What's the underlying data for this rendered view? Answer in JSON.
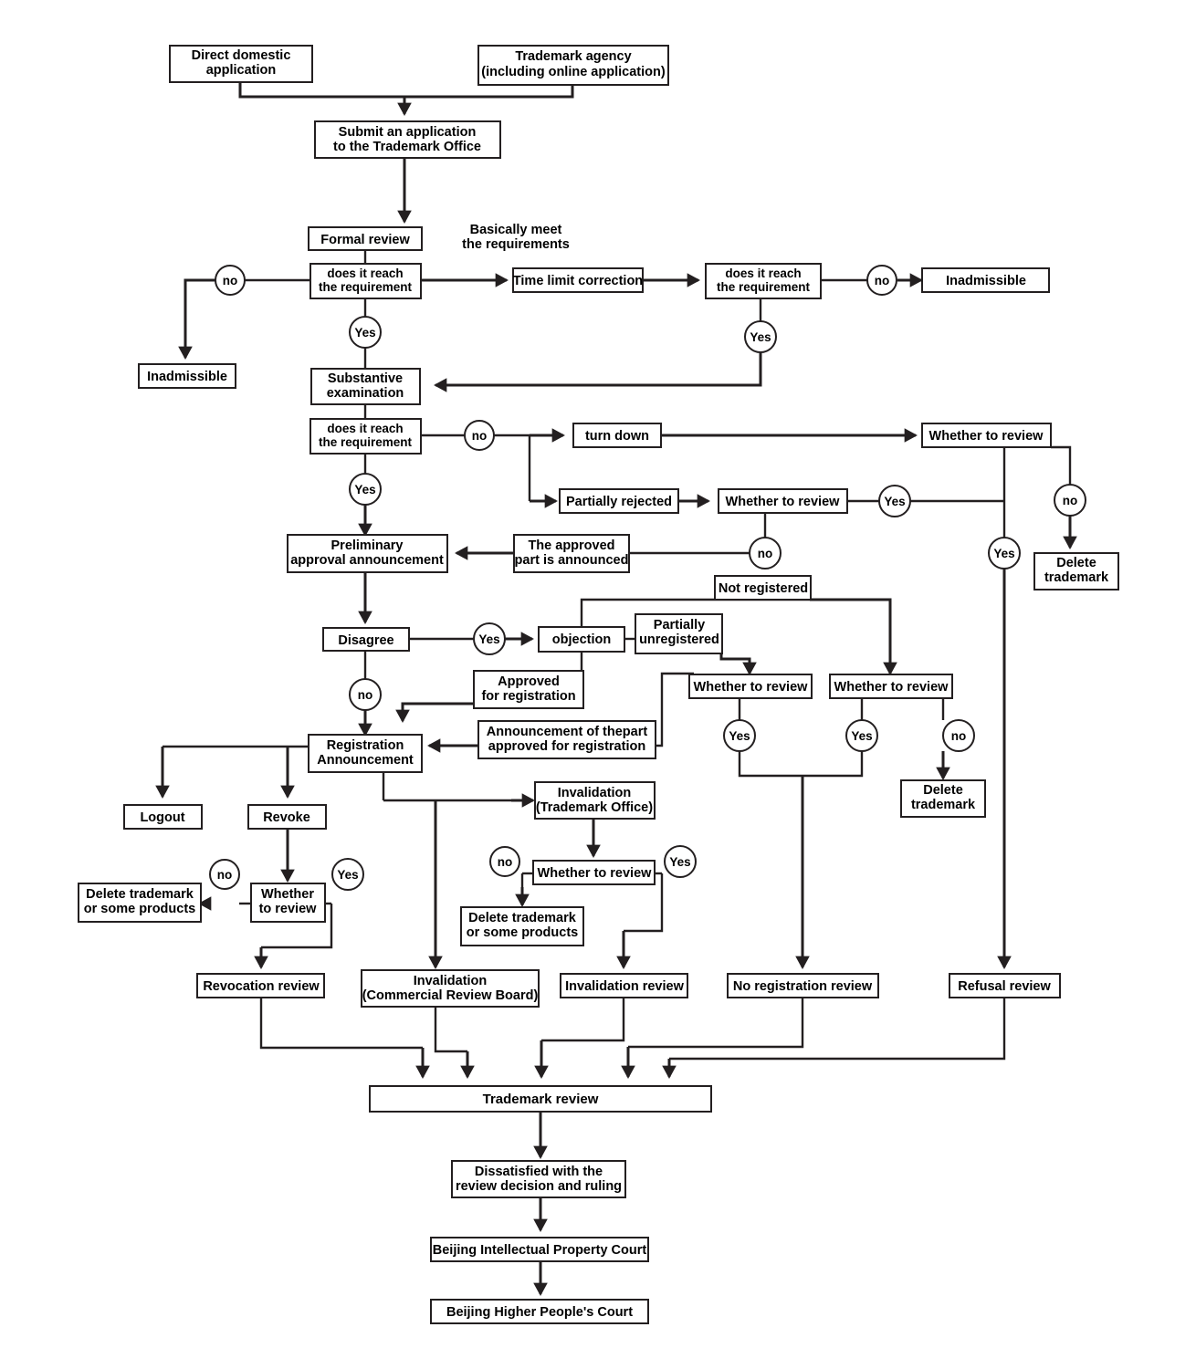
{
  "diagram": {
    "title": "Trademark application and review flowchart",
    "colors": {
      "line": "#231f20",
      "box_fill": "#ffffff",
      "background": "#ffffff"
    },
    "nodes": {
      "direct_domestic_application": {
        "lines": [
          "Direct domestic",
          "application"
        ]
      },
      "trademark_agency": {
        "lines": [
          "Trademark agency",
          "(including online application)"
        ]
      },
      "submit_application": {
        "lines": [
          "Submit an application",
          "to the Trademark Office"
        ]
      },
      "formal_review": {
        "lines": [
          "Formal review"
        ]
      },
      "formal_does_it_reach": {
        "lines": [
          "does it reach",
          "the requirement"
        ]
      },
      "inadmissible_left": {
        "lines": [
          "Inadmissible"
        ]
      },
      "time_limit_correction": {
        "lines": [
          "Time limit correction"
        ]
      },
      "correction_does_it_reach": {
        "lines": [
          "does it reach",
          "the requirement"
        ]
      },
      "inadmissible_right": {
        "lines": [
          "Inadmissible"
        ]
      },
      "substantive_examination": {
        "lines": [
          "Substantive",
          "examination"
        ]
      },
      "substantive_does_it_reach": {
        "lines": [
          "does it reach",
          "the requirement"
        ]
      },
      "turn_down": {
        "lines": [
          "turn down"
        ]
      },
      "whether_to_review_turndown": {
        "lines": [
          "Whether to review"
        ]
      },
      "partially_rejected": {
        "lines": [
          "Partially rejected"
        ]
      },
      "whether_to_review_partial": {
        "lines": [
          "Whether to review"
        ]
      },
      "delete_trademark_refusal": {
        "lines": [
          "Delete",
          "trademark"
        ]
      },
      "preliminary_approval": {
        "lines": [
          "Preliminary",
          "approval announcement"
        ]
      },
      "approved_part_announced": {
        "lines": [
          "The approved",
          "part is announced"
        ]
      },
      "disagree": {
        "lines": [
          "Disagree"
        ]
      },
      "objection": {
        "lines": [
          "objection"
        ]
      },
      "partially_unregistered": {
        "lines": [
          "Partially",
          "unregistered"
        ]
      },
      "not_registered": {
        "lines": [
          "Not registered"
        ]
      },
      "approved_for_registration": {
        "lines": [
          "Approved",
          "for registration"
        ]
      },
      "announcement_part_approved": {
        "lines": [
          "Announcement of thepart",
          "approved for registration"
        ]
      },
      "whether_to_review_partial_unreg": {
        "lines": [
          "Whether to review"
        ]
      },
      "whether_to_review_notreg": {
        "lines": [
          "Whether to review"
        ]
      },
      "delete_trademark_notreg": {
        "lines": [
          "Delete",
          "trademark"
        ]
      },
      "registration_announcement": {
        "lines": [
          "Registration",
          "Announcement"
        ]
      },
      "logout": {
        "lines": [
          "Logout"
        ]
      },
      "revoke": {
        "lines": [
          "Revoke"
        ]
      },
      "whether_to_review_revoke": {
        "lines": [
          "Whether",
          "to review"
        ]
      },
      "delete_trademark_or_products_revoke": {
        "lines": [
          "Delete trademark",
          "or some products"
        ]
      },
      "invalidation_trademark_office": {
        "lines": [
          "Invalidation",
          "(Trademark Office)"
        ]
      },
      "whether_to_review_invalidation": {
        "lines": [
          "Whether to review"
        ]
      },
      "delete_trademark_or_products_inval": {
        "lines": [
          "Delete trademark",
          "or some products"
        ]
      },
      "revocation_review": {
        "lines": [
          "Revocation review"
        ]
      },
      "invalidation_commercial_review_board": {
        "lines": [
          "Invalidation",
          "(Commercial Review Board)"
        ]
      },
      "invalidation_review": {
        "lines": [
          "Invalidation review"
        ]
      },
      "no_registration_review": {
        "lines": [
          "No registration review"
        ]
      },
      "refusal_review": {
        "lines": [
          "Refusal review"
        ]
      },
      "trademark_review": {
        "lines": [
          "Trademark review"
        ]
      },
      "dissatisfied": {
        "lines": [
          "Dissatisfied with the",
          "review decision and ruling"
        ]
      },
      "beijing_ip_court": {
        "lines": [
          "Beijing Intellectual Property Court"
        ]
      },
      "beijing_higher_court": {
        "lines": [
          "Beijing Higher People's Court"
        ]
      }
    },
    "annotations": {
      "basically_meet": {
        "lines": [
          "Basically meet",
          "the requirements"
        ]
      }
    },
    "decision_labels": {
      "formal_no": "no",
      "formal_yes": "Yes",
      "correction_no": "no",
      "correction_yes": "Yes",
      "substantive_no": "no",
      "substantive_yes": "Yes",
      "partial_review_yes": "Yes",
      "partial_review_no": "no",
      "turndown_review_yes": "Yes",
      "turndown_review_no": "no",
      "disagree_yes": "Yes",
      "disagree_no": "no",
      "partial_unreg_review_yes": "Yes",
      "notreg_review_yes": "Yes",
      "notreg_review_no": "no",
      "revoke_review_no": "no",
      "revoke_review_yes": "Yes",
      "invalidation_review_no": "no",
      "invalidation_review_yes": "Yes"
    }
  }
}
